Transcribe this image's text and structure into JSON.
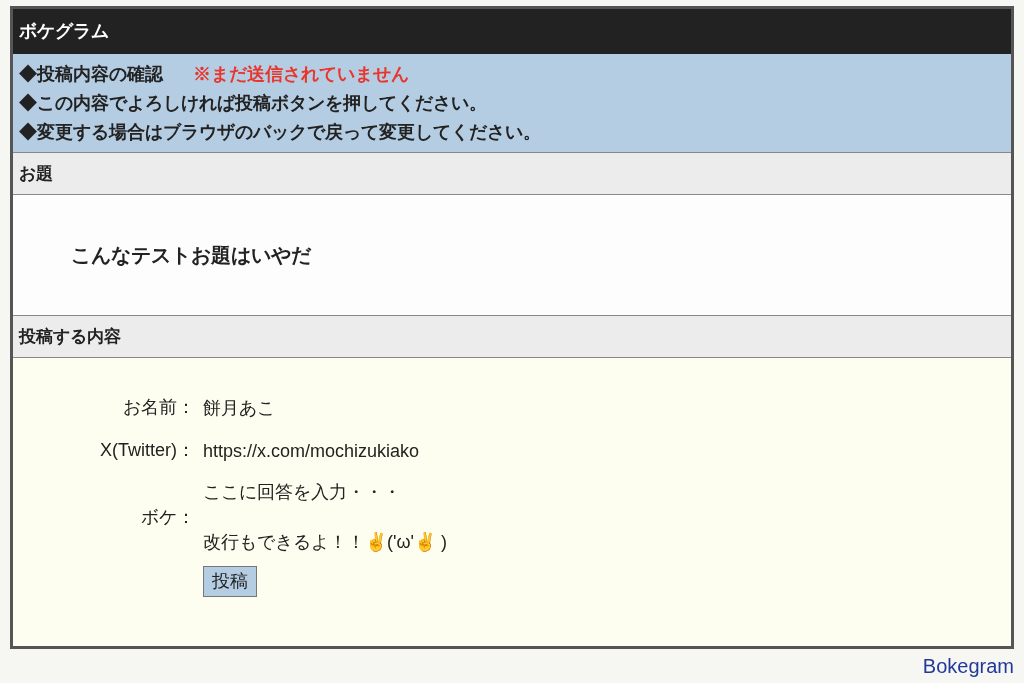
{
  "header": {
    "title": "ボケグラム"
  },
  "notice": {
    "lines": [
      {
        "text": "◆投稿内容の確認",
        "warning": "※まだ送信されていません"
      },
      {
        "text": "◆この内容でよろしければ投稿ボタンを押してください。"
      },
      {
        "text": "◆変更する場合はブラウザのバックで戻って変更してください。"
      }
    ]
  },
  "topic": {
    "heading": "お題",
    "text": "こんなテストお題はいやだ"
  },
  "submission": {
    "heading": "投稿する内容",
    "fields": [
      {
        "label": "お名前：",
        "lines": [
          "餅月あこ"
        ]
      },
      {
        "label": "X(Twitter)：",
        "lines": [
          "https://x.com/mochizukiako"
        ]
      },
      {
        "label": "ボケ：",
        "lines": [
          "ここに回答を入力・・・",
          "改行もできるよ！！✌('ω'✌ )"
        ]
      }
    ],
    "submit_button": "投稿"
  },
  "footer": {
    "link": "Bokegram"
  }
}
